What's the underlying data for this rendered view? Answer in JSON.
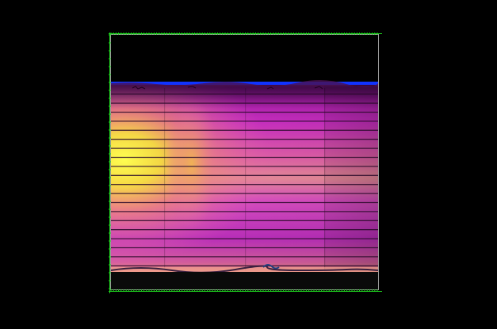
{
  "colors": {
    "background": "#000000",
    "frame_tick": "#1fd61f",
    "border": "#9a9a9a",
    "top_edge": "#1133ff",
    "stripe": "#2a0a2a",
    "colormap": [
      "#000000",
      "#5a0a6e",
      "#b01ab4",
      "#e23cd8",
      "#f070b0",
      "#f6a060",
      "#f8e040",
      "#ffff60"
    ]
  },
  "image": {
    "description_kind": "false-color scan with horizontal line artifacts",
    "stripe_count": 20,
    "tile_columns": 3
  }
}
